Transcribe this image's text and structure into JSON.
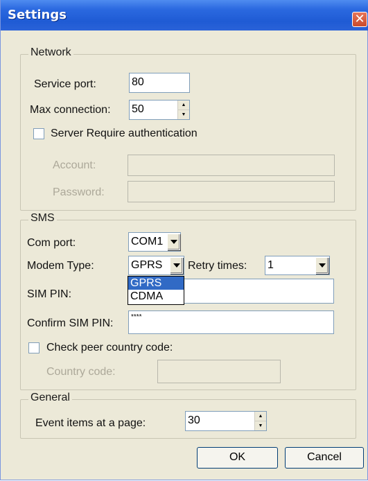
{
  "window": {
    "title": "Settings",
    "close_symbol": "✕"
  },
  "network": {
    "group_label": "Network",
    "service_port_label": "Service port:",
    "service_port_value": "80",
    "max_connection_label": "Max connection:",
    "max_connection_value": "50",
    "auth_label": "Server Require authentication",
    "auth_checked": false,
    "account_label": "Account:",
    "account_value": "",
    "password_label": "Password:",
    "password_value": ""
  },
  "sms": {
    "group_label": "SMS",
    "com_port_label": "Com port:",
    "com_port_value": "COM1",
    "modem_type_label": "Modem Type:",
    "modem_type_value": "GPRS",
    "modem_type_options": [
      "GPRS",
      "CDMA"
    ],
    "retry_label": "Retry times:",
    "retry_value": "1",
    "sim_pin_label": "SIM PIN:",
    "sim_pin_value": "",
    "confirm_pin_label": "Confirm SIM PIN:",
    "confirm_pin_value": "****",
    "peer_code_label": "Check peer country code:",
    "peer_code_checked": false,
    "country_code_label": "Country code:",
    "country_code_value": ""
  },
  "general": {
    "group_label": "General",
    "event_items_label": "Event items at a page:",
    "event_items_value": "30"
  },
  "buttons": {
    "ok_label": "OK",
    "cancel_label": "Cancel"
  },
  "colors": {
    "titlebar": "#2b69e0",
    "dialog_bg": "#ece9d8",
    "selection": "#316ac5",
    "close": "#c94a2c"
  }
}
